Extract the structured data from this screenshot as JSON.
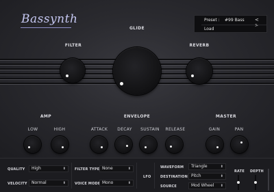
{
  "app": {
    "logo": "Bassynth"
  },
  "preset": {
    "label": "Preset :",
    "value": "#99 Bass",
    "nav": "< >",
    "load_label": "Load"
  },
  "sections": {
    "filter": "FILTER",
    "glide": "GLIDE",
    "reverb": "REVERB",
    "amp": "AMP",
    "envelope": "ENVELOPE",
    "master": "MASTER"
  },
  "knob_labels": {
    "low": "LOW",
    "high": "HIGH",
    "attack": "ATTACK",
    "decay": "DECAY",
    "sustain": "SUSTAIN",
    "release": "RELEASE",
    "gain": "GAIN",
    "pan": "PAN"
  },
  "bottom": {
    "quality": {
      "label": "QUALITY",
      "value": "High"
    },
    "velocity": {
      "label": "VELOCITY",
      "value": "Normal"
    },
    "filter_type": {
      "label": "FILTER TYPE",
      "value": "None"
    },
    "voice_mode": {
      "label": "VOICE MODE",
      "value": "Mono"
    },
    "lfo": {
      "label": "LFO"
    },
    "waveform": {
      "label": "WAVEFORM",
      "value": "Triangle"
    },
    "destination": {
      "label": "DESTINATION",
      "value": "Pitch"
    },
    "source": {
      "label": "SOURCE",
      "value": "Mod Wheel"
    },
    "rate": {
      "label": "RATE"
    },
    "depth": {
      "label": "DEPTH"
    },
    "arrow": "⬍"
  },
  "colors": {
    "logo": "#c6c8f2",
    "panel": "#2a2a2f",
    "knob": "#141416",
    "indicator": "#f2f2f2"
  }
}
